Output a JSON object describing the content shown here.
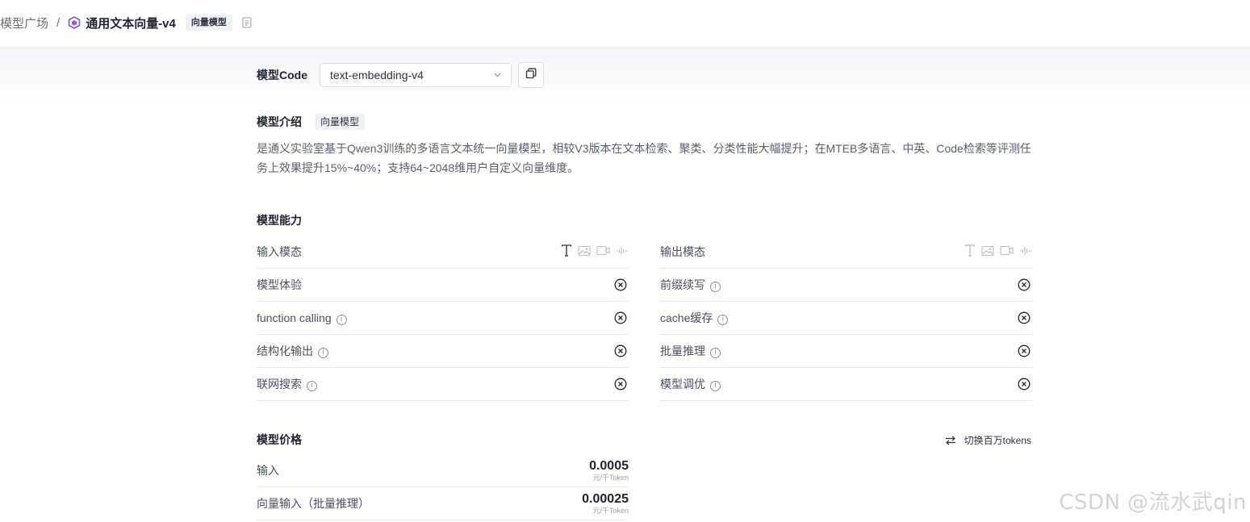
{
  "breadcrumb": {
    "parent": "模型广场",
    "separator": "/",
    "title": "通用文本向量-v4",
    "tag": "向量模型"
  },
  "model_code": {
    "label": "模型Code",
    "selected": "text-embedding-v4"
  },
  "intro": {
    "title": "模型介绍",
    "tag": "向量模型",
    "text": "是通义实验室基于Qwen3训练的多语言文本统一向量模型，相较V3版本在文本检索、聚类、分类性能大幅提升；在MTEB多语言、中英、Code检索等评测任务上效果提升15%~40%；支持64~2048维用户自定义向量维度。"
  },
  "capabilities": {
    "title": "模型能力",
    "left": [
      {
        "label": "输入模态"
      },
      {
        "label": "模型体验"
      },
      {
        "label": "function calling",
        "info": true
      },
      {
        "label": "结构化输出",
        "info": true
      },
      {
        "label": "联网搜索",
        "info": true
      }
    ],
    "right": [
      {
        "label": "输出模态"
      },
      {
        "label": "前缀续写",
        "info": true
      },
      {
        "label": "cache缓存",
        "info": true
      },
      {
        "label": "批量推理",
        "info": true
      },
      {
        "label": "模型调优",
        "info": true
      }
    ],
    "info_glyph": "i",
    "modal_icons": [
      "text-icon",
      "image-icon",
      "video-icon",
      "audio-icon"
    ]
  },
  "pricing": {
    "title": "模型价格",
    "switch_label": "切换百万tokens",
    "rows": [
      {
        "label": "输入",
        "value": "0.0005",
        "unit": "元/千Token"
      },
      {
        "label": "向量输入（批量推理）",
        "value": "0.00025",
        "unit": "元/千Token"
      }
    ]
  },
  "watermark": "CSDN @流水武qin"
}
